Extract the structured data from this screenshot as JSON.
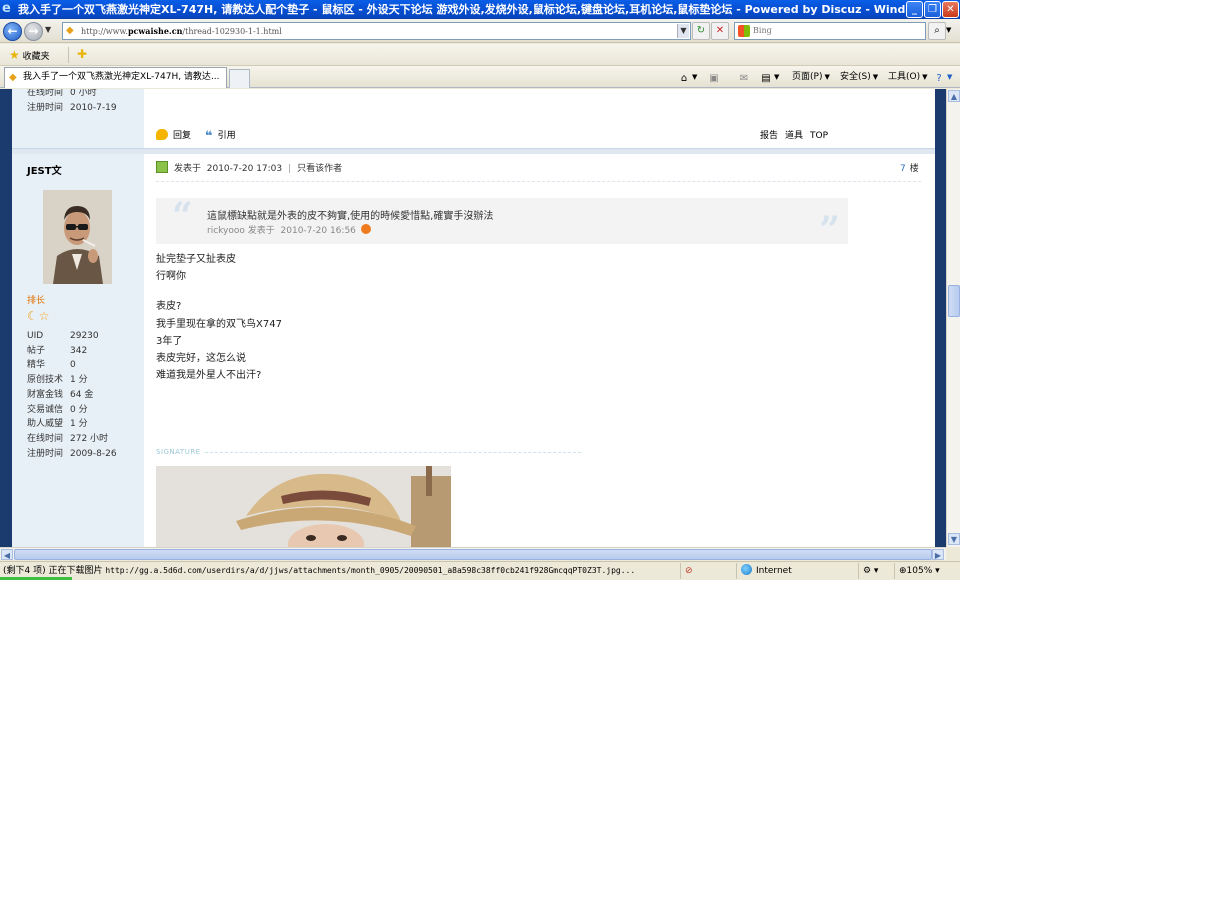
{
  "window": {
    "title": "我入手了一个双飞燕激光神定XL-747H, 请教达人配个垫子 - 鼠标区 - 外设天下论坛 游戏外设,发烧外设,鼠标论坛,键盘论坛,耳机论坛,鼠标垫论坛 - Powered by Discuz - Windo..."
  },
  "address_bar": {
    "url_prefix": "http://www.",
    "url_domain": "pcwaishe.cn",
    "url_path": "/thread-102930-1-1.html",
    "search_placeholder": "Bing"
  },
  "favorites_bar": {
    "favorites_label": "收藏夹"
  },
  "tabs": [
    {
      "label": "我入手了一个双飞燕激光神定XL-747H, 请教达..."
    }
  ],
  "command_bar": {
    "page_label": "页面(P)",
    "safety_label": "安全(S)",
    "tools_label": "工具(O)"
  },
  "prev_post": {
    "online_label": "在线时间",
    "online_value": "0 小时",
    "reg_label": "注册时间",
    "reg_value": "2010-7-19",
    "reply_label": "回复",
    "quote_label": "引用",
    "report_label": "报告",
    "tools_label": "道具",
    "top_label": "TOP"
  },
  "post": {
    "author": "JEST文",
    "rank": "排长",
    "stats": [
      {
        "label": "UID",
        "value": "29230"
      },
      {
        "label": "帖子",
        "value": "342"
      },
      {
        "label": "精华",
        "value": "0"
      },
      {
        "label": "原创技术",
        "value": "1 分"
      },
      {
        "label": "财富金钱",
        "value": "64 金"
      },
      {
        "label": "交易诚信",
        "value": "0 分"
      },
      {
        "label": "助人威望",
        "value": "1 分"
      },
      {
        "label": "在线时间",
        "value": "272 小时"
      },
      {
        "label": "注册时间",
        "value": "2009-8-26"
      }
    ],
    "posted_prefix": "发表于",
    "posted_time": "2010-7-20 17:03",
    "only_author": "只看该作者",
    "floor_number": "7",
    "floor_suffix": "楼",
    "quote": {
      "text": "這鼠標缺點就是外表的皮不夠實,使用的時候愛惜點,確實手沒辦法",
      "author": "rickyooo",
      "posted_prefix": "发表于",
      "time": "2010-7-20 16:56"
    },
    "body_lines": [
      "扯完垫子又扯表皮",
      "行啊你",
      "表皮?",
      "我手里现在拿的双飞鸟X747",
      "3年了",
      "表皮完好，这怎么说",
      "难道我是外星人不出汗?"
    ],
    "signature_label": "SIGNATURE"
  },
  "status_bar": {
    "text": "(剩下4 项) 正在下载图片",
    "url": "http://gg.a.5d6d.com/userdirs/a/d/jjws/attachments/month_0905/20090501_a8a598c38ff0cb241f928GmcqqPT0Z3T.jpg...",
    "zone": "Internet",
    "zoom": "105%"
  },
  "colors": {
    "title_bar": "#0651d6",
    "forum_frame": "#1b3a6e",
    "profile_bg": "#e8f0f7",
    "rank_color": "#e07000",
    "link_blue": "#2a6fb8"
  }
}
